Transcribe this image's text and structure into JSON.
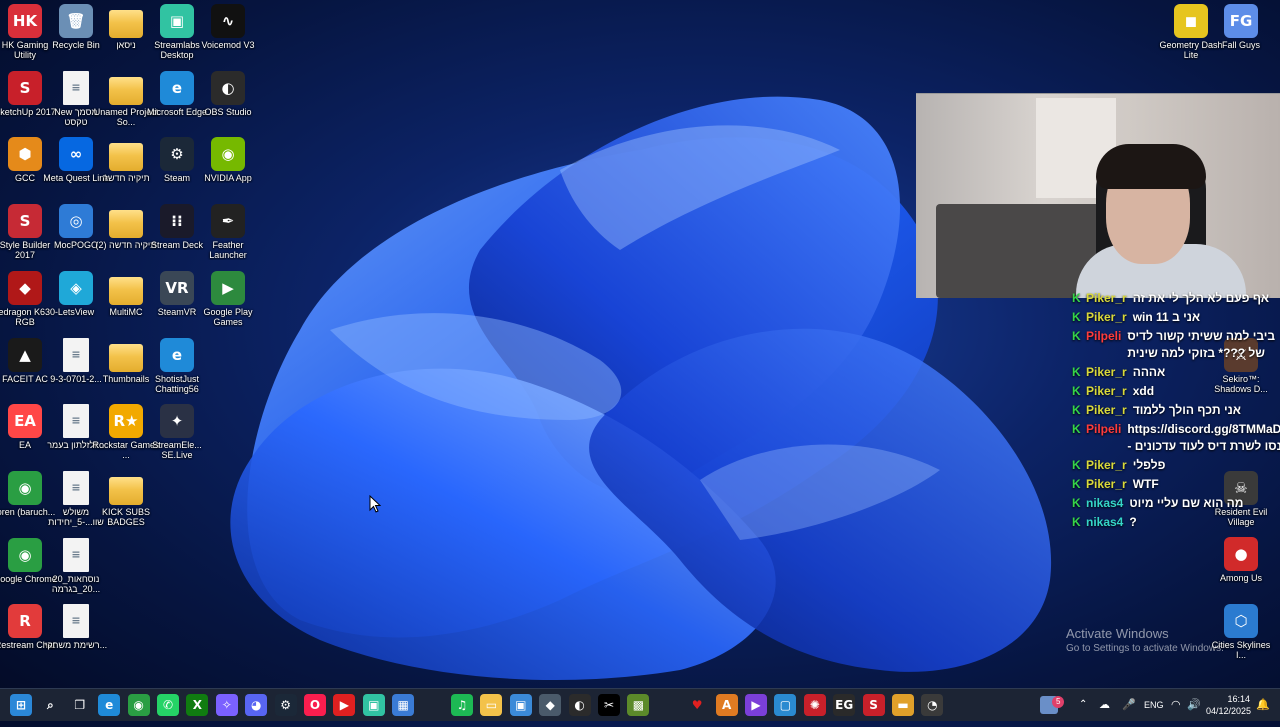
{
  "desktop": {
    "col1": [
      {
        "label": "HK Gaming Utility",
        "icon": "hk-gaming-icon",
        "glyph": "HK",
        "color": "#d92f3a"
      },
      {
        "label": "SketchUp 2017",
        "icon": "sketchup-icon",
        "glyph": "S",
        "color": "#c8202a"
      },
      {
        "label": "GCC",
        "icon": "gcc-icon",
        "glyph": "⬢",
        "color": "#e58a1a"
      },
      {
        "label": "Style Builder 2017",
        "icon": "style-builder-icon",
        "glyph": "S",
        "color": "#c62a35"
      },
      {
        "label": "Redragon K630-RGB",
        "icon": "redragon-icon",
        "glyph": "◆",
        "color": "#b01818"
      },
      {
        "label": "FACEIT AC",
        "icon": "faceit-icon",
        "glyph": "▲",
        "color": "#1a1a1a"
      },
      {
        "label": "EA",
        "icon": "ea-icon",
        "glyph": "EA",
        "color": "#ff4747"
      },
      {
        "label": "loren (baruch...",
        "icon": "chrome-profile-icon",
        "glyph": "◉",
        "color": "#2a9e43"
      },
      {
        "label": "Google Chrome",
        "icon": "chrome-icon",
        "glyph": "◉",
        "color": "#2a9e43"
      },
      {
        "label": "Restream Chat",
        "icon": "restream-icon",
        "glyph": "R",
        "color": "#e23b3b"
      }
    ],
    "col2": [
      {
        "label": "Recycle Bin",
        "icon": "recycle-bin-icon",
        "glyph": "🗑",
        "color": "#6b8fb5"
      },
      {
        "label": "New מסמך טקסט",
        "icon": "text-document-icon",
        "glyph": "≡",
        "color": "doc"
      },
      {
        "label": "Meta Quest Link",
        "icon": "meta-quest-icon",
        "glyph": "∞",
        "color": "#0668e1"
      },
      {
        "label": "MocPOGO",
        "icon": "mocpogo-icon",
        "glyph": "◎",
        "color": "#2e7bd6"
      },
      {
        "label": "LetsView",
        "icon": "letsview-icon",
        "glyph": "◈",
        "color": "#1fa8d8"
      },
      {
        "label": "9-3-0701-2...",
        "icon": "document-icon",
        "glyph": "≡",
        "color": "doc"
      },
      {
        "label": "זלזלתון בעמר...",
        "icon": "document-icon",
        "glyph": "≡",
        "color": "doc"
      },
      {
        "label": "משולש שוו...-5_יחידות",
        "icon": "document-icon",
        "glyph": "≡",
        "color": "doc"
      },
      {
        "label": "20_נוסחאות ...20_בגרמה",
        "icon": "document-icon",
        "glyph": "≡",
        "color": "doc"
      },
      {
        "label": "רשימת משחקי...",
        "icon": "document-icon",
        "glyph": "≡",
        "color": "doc"
      }
    ],
    "col3": [
      {
        "label": "ניסאן",
        "icon": "folder-icon",
        "glyph": "",
        "color": "folder"
      },
      {
        "label": "Unamed Project So...",
        "icon": "folder-icon",
        "glyph": "",
        "color": "folder"
      },
      {
        "label": "תיקיה חדשה",
        "icon": "folder-icon",
        "glyph": "",
        "color": "folder"
      },
      {
        "label": "תיקיה חדשה (2)",
        "icon": "folder-icon",
        "glyph": "",
        "color": "folder"
      },
      {
        "label": "MultiMC",
        "icon": "folder-icon",
        "glyph": "",
        "color": "folder"
      },
      {
        "label": "Thumbnails",
        "icon": "folder-icon",
        "glyph": "",
        "color": "folder"
      },
      {
        "label": "Rockstar Games ...",
        "icon": "rockstar-icon",
        "glyph": "R★",
        "color": "#f2a900"
      },
      {
        "label": "KICK SUBS BADGES",
        "icon": "folder-icon",
        "glyph": "",
        "color": "folder"
      }
    ],
    "col4": [
      {
        "label": "Streamlabs Desktop",
        "icon": "streamlabs-icon",
        "glyph": "▣",
        "color": "#31c3a2"
      },
      {
        "label": "Microsoft Edge",
        "icon": "edge-icon",
        "glyph": "e",
        "color": "#1f8ad8"
      },
      {
        "label": "Steam",
        "icon": "steam-icon",
        "glyph": "⚙",
        "color": "#1b2838"
      },
      {
        "label": "Stream Deck",
        "icon": "stream-deck-icon",
        "glyph": "⁝⁝",
        "color": "#1a1a2a"
      },
      {
        "label": "SteamVR",
        "icon": "steamvr-icon",
        "glyph": "VR",
        "color": "#3a4756"
      },
      {
        "label": "ShotistJust Chatting56",
        "icon": "edge-shortcut-icon",
        "glyph": "e",
        "color": "#1f8ad8"
      },
      {
        "label": "StreamEle... SE.Live",
        "icon": "streamelements-icon",
        "glyph": "✦",
        "color": "#2a3145"
      }
    ],
    "col5": [
      {
        "label": "Voicemod V3",
        "icon": "voicemod-icon",
        "glyph": "∿",
        "color": "#111111"
      },
      {
        "label": "OBS Studio",
        "icon": "obs-icon",
        "glyph": "◐",
        "color": "#2b2b2b"
      },
      {
        "label": "NVIDIA App",
        "icon": "nvidia-icon",
        "glyph": "◉",
        "color": "#76b900"
      },
      {
        "label": "Feather Launcher",
        "icon": "feather-icon",
        "glyph": "✒",
        "color": "#222222"
      },
      {
        "label": "Google Play Games",
        "icon": "google-play-games-icon",
        "glyph": "▶",
        "color": "#2d8a3e"
      }
    ],
    "right": [
      {
        "label": "Geometry Dash Lite",
        "icon": "geometry-dash-icon",
        "glyph": "◼",
        "color": "#e6c51f"
      },
      {
        "label": "Fall Guys",
        "icon": "fall-guys-icon",
        "glyph": "FG",
        "color": "#5d8de8"
      },
      {
        "label": "Sekiro™: Shadows D...",
        "icon": "sekiro-icon",
        "glyph": "⚔",
        "color": "#5a3b2e"
      },
      {
        "label": "Resident Evil Village",
        "icon": "resident-evil-icon",
        "glyph": "☠",
        "color": "#3a3a3a"
      },
      {
        "label": "Among Us",
        "icon": "among-us-icon",
        "glyph": "●",
        "color": "#d12a2a"
      },
      {
        "label": "Cities Skylines I...",
        "icon": "cities-skylines-icon",
        "glyph": "⬡",
        "color": "#2b7bd0"
      }
    ]
  },
  "chat": {
    "lines": [
      {
        "user": "Piker_r",
        "color": "#d9d93a",
        "msg": "אף פעם לא הלך לי את זה",
        "badge": "K"
      },
      {
        "user": "Piker_r",
        "color": "#d9d93a",
        "msg": "win 11 אני ב",
        "badge": "K"
      },
      {
        "user": "Pilpeli",
        "color": "#ff3b3b",
        "msg": "ביבי למה ששיתי קשור לדיס של ???* בזוקי למה שינית",
        "badge": "K"
      },
      {
        "user": "Piker_r",
        "color": "#d9d93a",
        "msg": "אההה",
        "badge": "K"
      },
      {
        "user": "Piker_r",
        "color": "#d9d93a",
        "msg": "xdd",
        "badge": "K"
      },
      {
        "user": "Piker_r",
        "color": "#d9d93a",
        "msg": "אני תכף הולך ללמוד",
        "badge": "K"
      },
      {
        "user": "Pilpeli",
        "color": "#ff3b3b",
        "msg": "https://discord.gg/8TMMaDwx - כנסו לשרת דיס לעוד עדכונים",
        "badge": "K"
      },
      {
        "user": "Piker_r",
        "color": "#d9d93a",
        "msg": "פלפלי",
        "badge": "K"
      },
      {
        "user": "Piker_r",
        "color": "#d9d93a",
        "msg": "WTF",
        "badge": "K"
      },
      {
        "user": "nikas4",
        "color": "#35d6c8",
        "msg": "מה הוא שם עליי מיוט",
        "badge": "K"
      },
      {
        "user": "nikas4",
        "color": "#35d6c8",
        "msg": "?",
        "badge": "K"
      }
    ]
  },
  "watermark": {
    "title": "Activate Windows",
    "subtitle": "Go to Settings to activate Windows."
  },
  "taskbar": {
    "apps": [
      {
        "icon": "windows-start-icon",
        "glyph": "⊞",
        "color": "#2b88d8"
      },
      {
        "icon": "search-icon",
        "glyph": "⌕",
        "color": "transparent"
      },
      {
        "icon": "task-view-icon",
        "glyph": "❐",
        "color": "transparent"
      },
      {
        "icon": "edge-icon",
        "glyph": "e",
        "color": "#1f8ad8"
      },
      {
        "icon": "chrome-icon",
        "glyph": "◉",
        "color": "#2a9e43"
      },
      {
        "icon": "whatsapp-icon",
        "glyph": "✆",
        "color": "#25d366"
      },
      {
        "icon": "xbox-icon",
        "glyph": "X",
        "color": "#107c10"
      },
      {
        "icon": "copilot-icon",
        "glyph": "✧",
        "color": "#7b61ff"
      },
      {
        "icon": "discord-icon",
        "glyph": "◕",
        "color": "#5865f2"
      },
      {
        "icon": "steam-icon",
        "glyph": "⚙",
        "color": "#1b2838"
      },
      {
        "icon": "opera-gx-icon",
        "glyph": "O",
        "color": "#fa1e4e"
      },
      {
        "icon": "youtube-icon",
        "glyph": "▶",
        "color": "#e02020"
      },
      {
        "icon": "streamlabs-icon",
        "glyph": "▣",
        "color": "#31c3a2"
      },
      {
        "icon": "store-icon",
        "glyph": "▦",
        "color": "#3a7bd5"
      },
      {
        "icon": "blank-app-icon",
        "glyph": "",
        "color": "transparent"
      },
      {
        "icon": "spotify-icon",
        "glyph": "♫",
        "color": "#1db954"
      },
      {
        "icon": "file-explorer-icon",
        "glyph": "▭",
        "color": "#f3c24a"
      },
      {
        "icon": "window-app-icon",
        "glyph": "▣",
        "color": "#3b8ad8"
      },
      {
        "icon": "shield-icon",
        "glyph": "◆",
        "color": "#4a5a6a"
      },
      {
        "icon": "obs-icon",
        "glyph": "◐",
        "color": "#2b2b2b"
      },
      {
        "icon": "capcut-icon",
        "glyph": "✂",
        "color": "#000000"
      },
      {
        "icon": "minecraft-icon",
        "glyph": "▩",
        "color": "#5c8a2a"
      },
      {
        "icon": "blank-app-icon",
        "glyph": "",
        "color": "transparent"
      },
      {
        "icon": "heart-app-icon",
        "glyph": "♥",
        "color": "transparent"
      },
      {
        "icon": "app-a-icon",
        "glyph": "A",
        "color": "#e07b22"
      },
      {
        "icon": "clapper-icon",
        "glyph": "▶",
        "color": "#7b3fd8"
      },
      {
        "icon": "app-window-icon",
        "glyph": "▢",
        "color": "#2a8ad0"
      },
      {
        "icon": "hk-gaming-icon",
        "glyph": "✺",
        "color": "#c8202a"
      },
      {
        "icon": "epic-games-icon",
        "glyph": "EG",
        "color": "#2a2a2a"
      },
      {
        "icon": "sketchup-icon",
        "glyph": "S",
        "color": "#c8202a"
      },
      {
        "icon": "wallet-icon",
        "glyph": "▬",
        "color": "#e0a02a"
      },
      {
        "icon": "speedometer-icon",
        "glyph": "◔",
        "color": "#3a3a3a"
      }
    ],
    "tray": {
      "notification_count": "5",
      "language": "ENG",
      "time": "16:14",
      "date": "04/12/2025"
    }
  }
}
